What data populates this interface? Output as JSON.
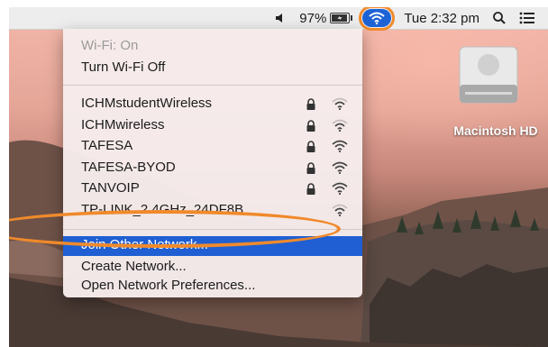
{
  "menubar": {
    "battery_percent": "97%",
    "battery_level": 0.97,
    "clock": "Tue 2:32 pm",
    "icons": [
      "volume-icon",
      "battery-charging-icon",
      "wifi-icon",
      "spotlight-search-icon",
      "notification-center-icon"
    ]
  },
  "wifi_menu": {
    "status": "Wi-Fi: On",
    "toggle_label": "Turn Wi-Fi Off",
    "networks": [
      {
        "name": "ICHMstudentWireless",
        "locked": true,
        "signal": 2
      },
      {
        "name": "ICHMwireless",
        "locked": true,
        "signal": 2
      },
      {
        "name": "TAFESA",
        "locked": true,
        "signal": 3
      },
      {
        "name": "TAFESA-BYOD",
        "locked": true,
        "signal": 3
      },
      {
        "name": "TANVOIP",
        "locked": true,
        "signal": 3
      },
      {
        "name": "TP-LINK_2.4GHz_24DF8B",
        "locked": false,
        "signal": 2
      }
    ],
    "join_other": "Join Other Network...",
    "create_network": "Create Network...",
    "preferences": "Open Network Preferences..."
  },
  "desktop": {
    "drive_label": "Macintosh HD"
  },
  "colors": {
    "highlight": "#1f5fd3",
    "annotation": "#f08a2b",
    "menu_bg": "#f6ecec"
  }
}
